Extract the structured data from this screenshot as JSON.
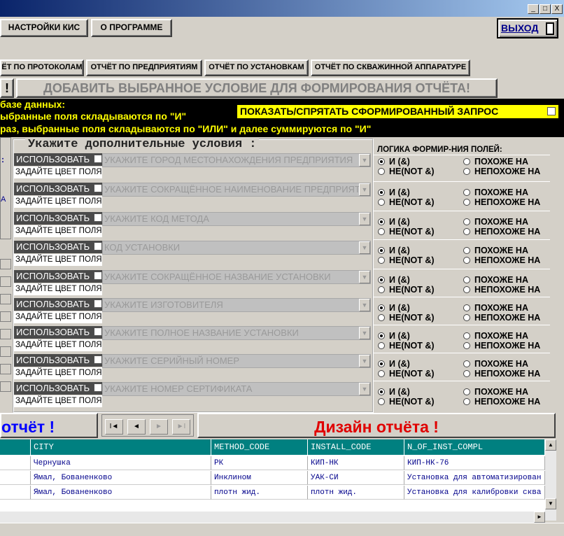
{
  "window": {
    "min": "_",
    "max": "□",
    "close": "X"
  },
  "menu": {
    "settings": "НАСТРОЙКИ КИС",
    "about": "О ПРОГРАММЕ",
    "exit": "ВЫХОД"
  },
  "reports": [
    "ЁТ ПО ПРОТОКОЛАМ",
    "ОТЧЁТ ПО ПРЕДПРИЯТИЯМ",
    "ОТЧЁТ ПО УСТАНОВКАМ",
    "ОТЧЁТ ПО СКВАЖИННОЙ АППАРАТУРЕ"
  ],
  "add_condition": {
    "excl": "!",
    "label": "ДОБАВИТЬ ВЫБРАННОЕ УСЛОВИЕ ДЛЯ ФОРМИРОВАНИЯ  ОТЧЁТА!"
  },
  "info": {
    "line1": "базе данных:",
    "line2": "ыбранные поля складываются по \"И\"",
    "line3": "раз, выбранные поля складываются по \"ИЛИ\" и далее суммируются по \"И\"",
    "show_query": "ПОКАЗАТЬ/СПРЯТАТЬ СФОРМИРОВАННЫЙ ЗАПРОС"
  },
  "conditions": {
    "title": "Укажите дополнительные условия :",
    "logic_title": "ЛОГИКА ФОРМИР-НИЯ ПОЛЕЙ:",
    "use_label": "ИСПОЛЬЗОВАТЬ",
    "color_label": "ЗАДАЙТЕ ЦВЕТ ПОЛЯ",
    "and_label": "И     (&)",
    "not_and_label": "НЕ(NOT &)",
    "like_label": "ПОХОЖЕ НА",
    "not_like_label": "НЕПОХОЖЕ НА",
    "rows": [
      "УКАЖИТЕ ГОРОД МЕСТОНАХОЖДЕНИЯ ПРЕДПРИЯТИЯ",
      "УКАЖИТЕ СОКРАЩЁННОЕ НАИМЕНОВАНИЕ ПРЕДПРИЯТИЯ",
      "УКАЖИТЕ КОД МЕТОДА",
      "КОД УСТАНОВКИ",
      "УКАЖИТЕ СОКРАЩЁННОЕ НАЗВАНИЕ УСТАНОВКИ",
      "УКАЖИТЕ ИЗГОТОВИТЕЛЯ",
      "УКАЖИТЕ ПОЛНОЕ НАЗВАНИЕ УСТАНОВКИ",
      "УКАЖИТЕ СЕРИЙНЫЙ НОМЕР",
      "УКАЖИТЕ НОМЕР СЕРТИФИКАТА"
    ]
  },
  "left_fragments": {
    "a": ":",
    "b": "А"
  },
  "bottom": {
    "report": "отчёт !",
    "design": "Дизайн  отчёта !",
    "nav_first": "I◄",
    "nav_prev": "◄",
    "nav_next": "►",
    "nav_last": "►I"
  },
  "grid": {
    "columns": [
      "",
      "CITY",
      "METHOD_CODE",
      "INSTALL_CODE",
      "N_OF_INST_COMPL"
    ],
    "rows": [
      [
        "",
        "Чернушка",
        "РК",
        "КИП-НК",
        "КИП-НК-76"
      ],
      [
        "",
        "Ямал, Бованенково",
        "Инклином",
        "УАК-СИ",
        "Установка для автоматизирован"
      ],
      [
        "",
        "Ямал, Бованенково",
        "плотн жид.",
        "плотн жид.",
        "Установка для калибровки сква"
      ]
    ]
  },
  "colors": {
    "header_teal": "#008080",
    "info_bg": "#000000",
    "info_text": "#ffff00",
    "report_blue": "#0000ff",
    "design_red": "#e00000"
  }
}
